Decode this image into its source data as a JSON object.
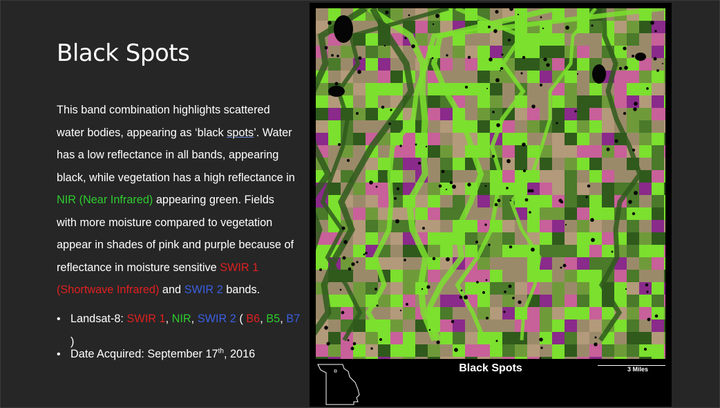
{
  "slide": {
    "title": "Black Spots",
    "paragraph": {
      "p1": "This band combination highlights scattered water bodies, appearing as ‘black ",
      "p2": "spots",
      "p3": "’. Water has a low reflectance in all bands, appearing black, while vegetation has a high reflectance in ",
      "p4": "NIR (Near Infrared)",
      "p5": " appearing green. Fields with more moisture compared to vegetation appear in shades of pink and purple because of reflectance in moisture sensitive ",
      "p6": "SWIR 1 (Shortwave Infrared)",
      "p7": " and ",
      "p8": "SWIR 2",
      "p9": " bands."
    },
    "bullet1": {
      "prefix": "Landsat-8: ",
      "b1": "SWIR 1",
      "sep1": ", ",
      "b2": "NIR",
      "sep2": ", ",
      "b3": "SWIR 2",
      "open": " ( ",
      "c1": "B6",
      "sep3": ", ",
      "c2": "B5",
      "sep4": ", ",
      "c3": "B7",
      "close": " )"
    },
    "bullet2": {
      "prefix": "Date Acquired: September 17",
      "sup": "th",
      "suffix": ", 2016"
    }
  },
  "map": {
    "title": "Black Spots",
    "scale": "3 Miles",
    "colors": {
      "vegetation": "#7be02e",
      "dark_vegetation": "#2f5a1c",
      "field_tan": "#9b8a6a",
      "moist_pink": "#c8609a",
      "moist_purple": "#8a2a8a",
      "water": "#050505"
    }
  }
}
